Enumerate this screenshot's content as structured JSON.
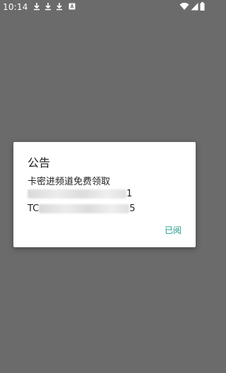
{
  "status_bar": {
    "time": "10:14",
    "icons_left": [
      "download-icon",
      "download-icon",
      "download-icon",
      "notification-icon"
    ],
    "icons_right": [
      "wifi-icon",
      "cell-signal-icon",
      "battery-icon"
    ]
  },
  "dialog": {
    "title": "公告",
    "message_line1": "卡密进频道免费领取",
    "message_line2_suffix": "1",
    "message_line3_prefix": "TC",
    "message_line3_suffix": "5",
    "action_label": "已阅"
  },
  "colors": {
    "scrim": "#6b6b6b",
    "accent": "#1a9a8a",
    "text": "#212121"
  }
}
